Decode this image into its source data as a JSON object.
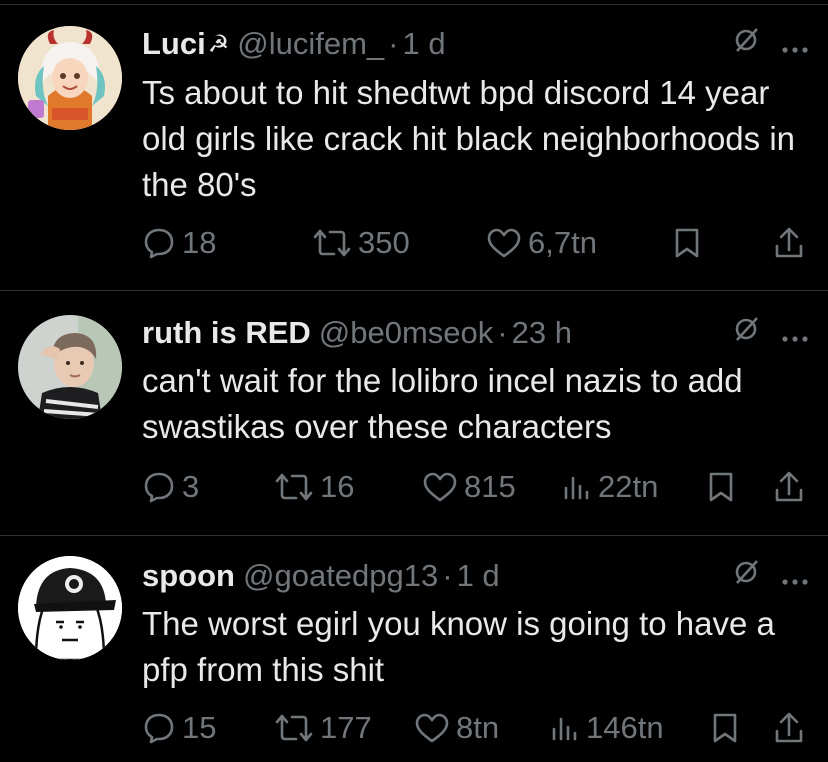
{
  "tweets": [
    {
      "name": "Luci",
      "name_emoji": "☭",
      "handle": "@lucifem_",
      "dot": "·",
      "time": "1 d",
      "text": "Ts about to hit shedtwt bpd discord 14 year old girls like crack hit black neighborhoods in the 80's",
      "replies": "18",
      "reposts": "350",
      "likes": "6,7tn",
      "views": ""
    },
    {
      "name": "ruth is RED",
      "name_emoji": "",
      "handle": "@be0mseok",
      "dot": "·",
      "time": "23 h",
      "text": "can't wait for the lolibro incel nazis to add swastikas over these characters",
      "replies": "3",
      "reposts": "16",
      "likes": "815",
      "views": "22tn"
    },
    {
      "name": "spoon",
      "name_emoji": "",
      "handle": "@goatedpg13",
      "dot": "·",
      "time": "1 d",
      "text": "The worst egirl you know is going to have a pfp from this shit",
      "replies": "15",
      "reposts": "177",
      "likes": "8tn",
      "views": "146tn"
    }
  ],
  "icons": {
    "grok": "grok-icon",
    "more": "more-icon",
    "reply": "reply-icon",
    "repost": "repost-icon",
    "like": "like-icon",
    "views": "views-icon",
    "bookmark": "bookmark-icon",
    "share": "share-icon"
  },
  "colors": {
    "background": "#000000",
    "text": "#e7e9ea",
    "secondary": "#71767b",
    "divider": "#2f3336"
  }
}
